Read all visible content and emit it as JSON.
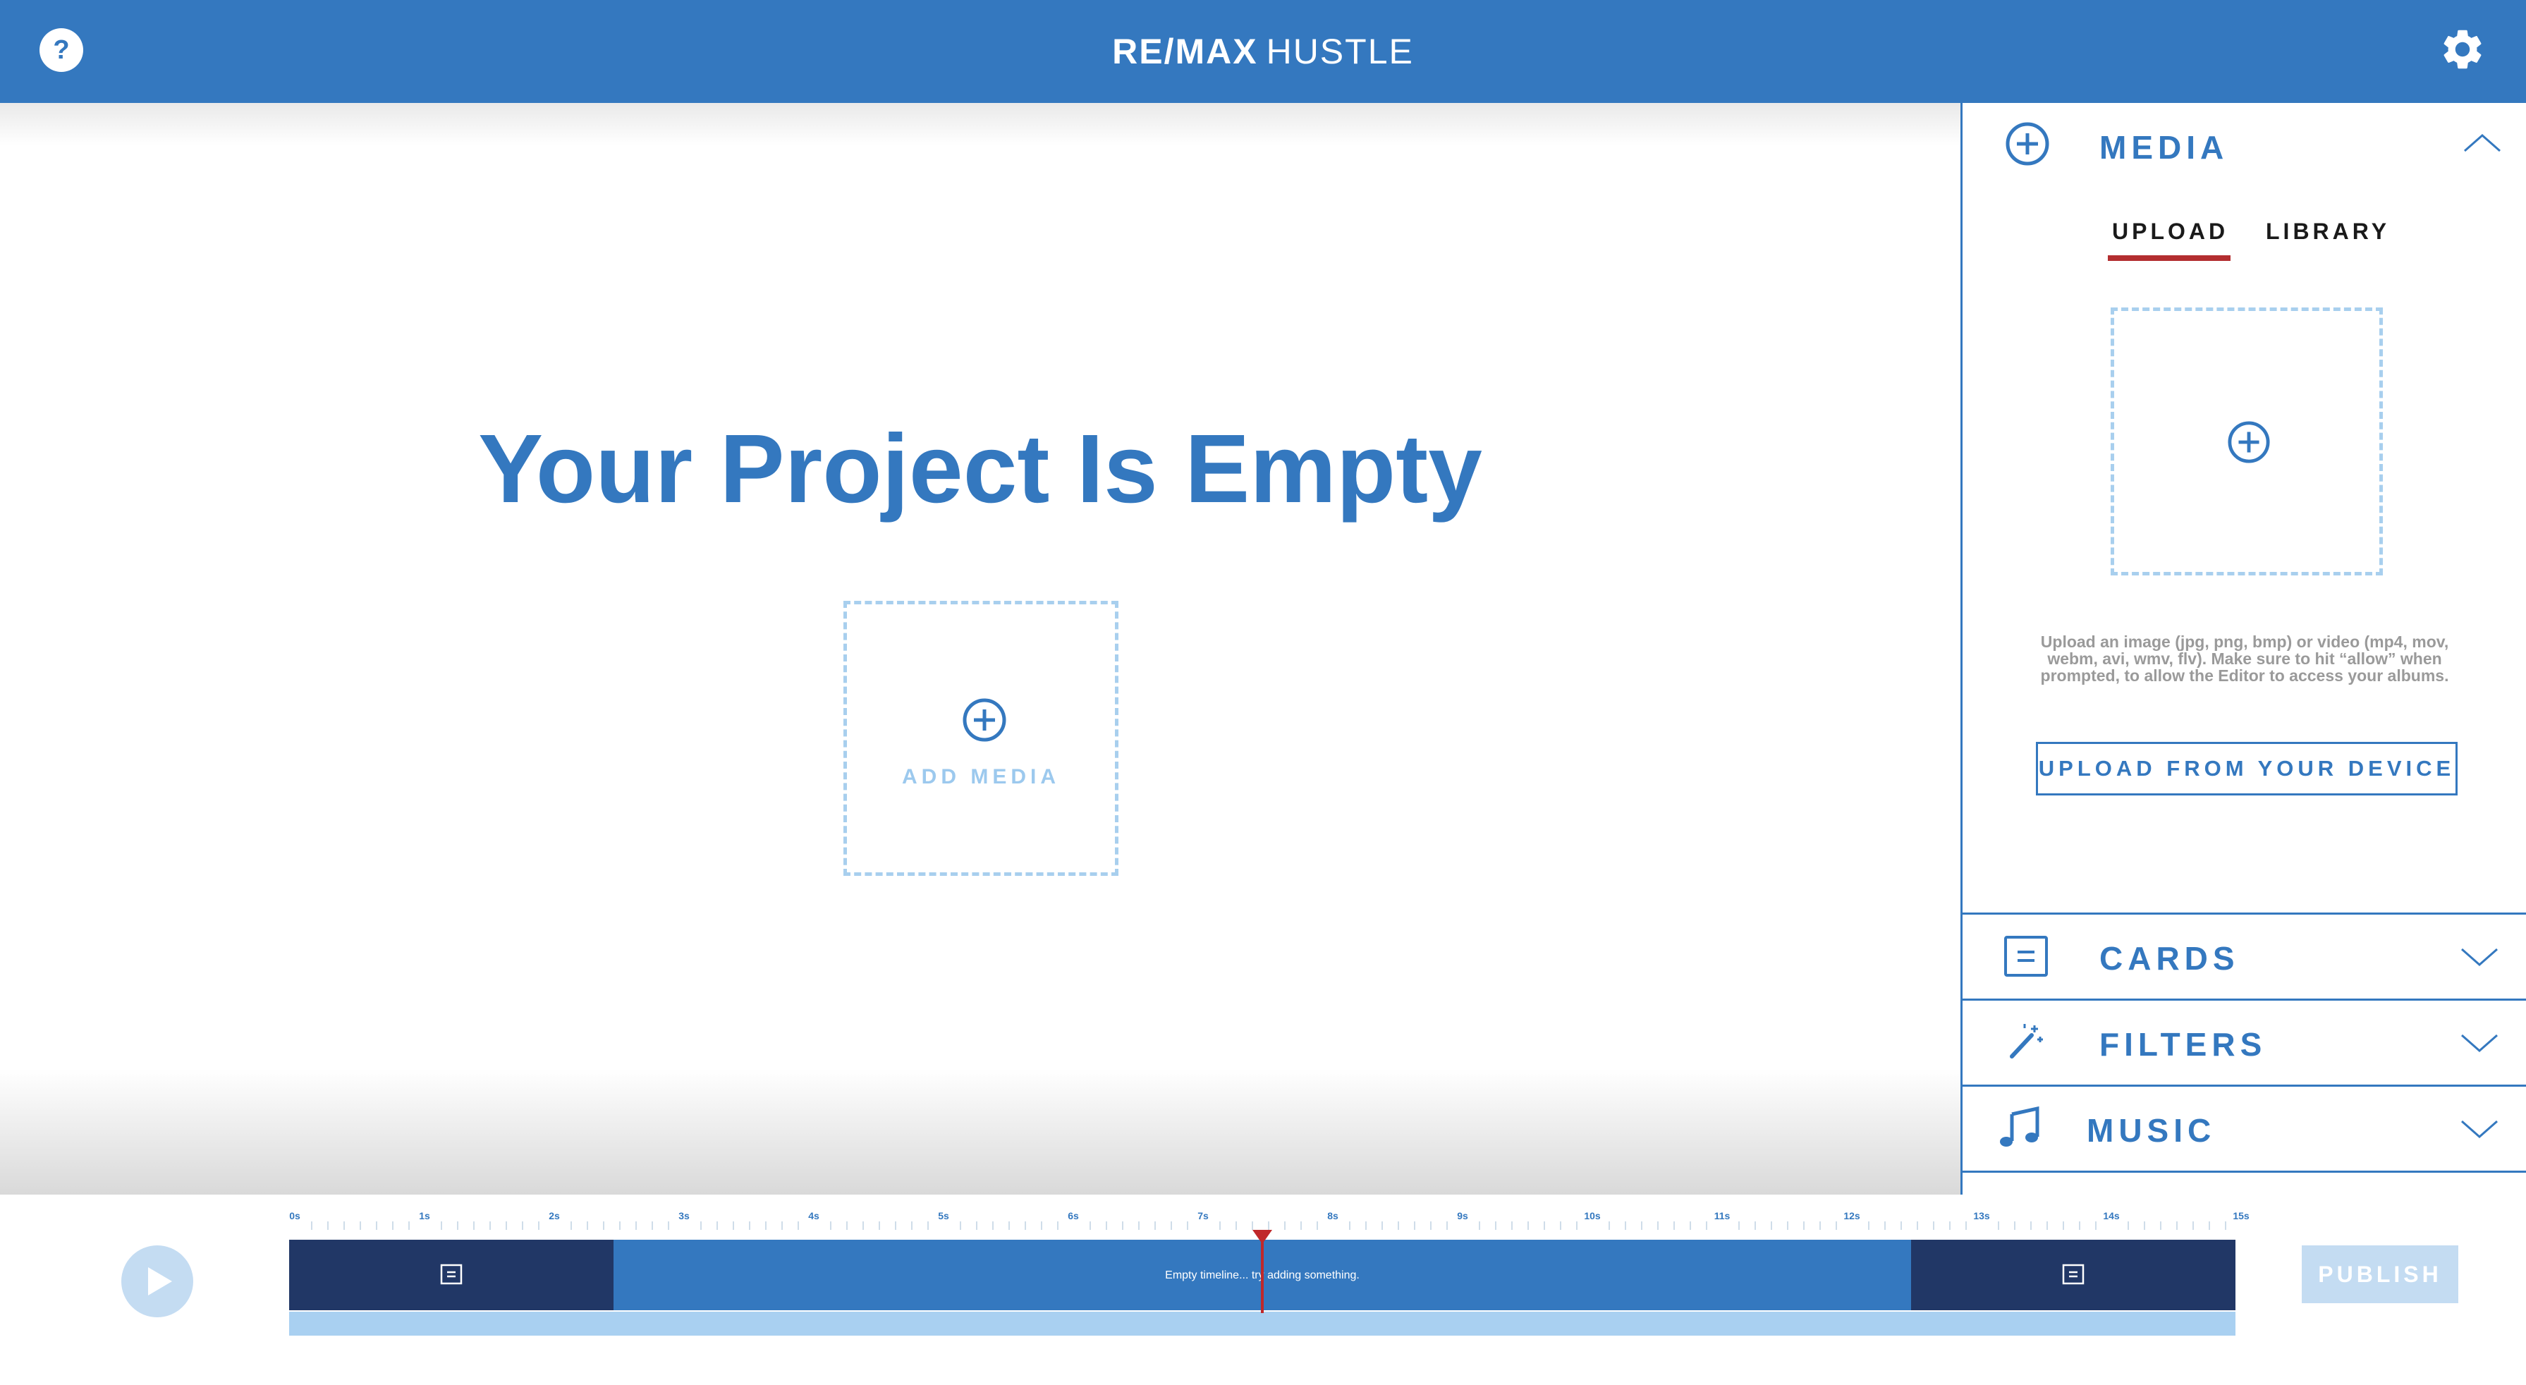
{
  "header": {
    "help_label": "?",
    "brand_primary": "RE/MAX",
    "brand_secondary": "HUSTLE",
    "settings_icon": "gear-icon"
  },
  "stage": {
    "title": "Your Project Is Empty",
    "add_media_label": "ADD MEDIA"
  },
  "sidebar": {
    "media": {
      "title": "MEDIA",
      "expanded": true,
      "tabs": [
        {
          "label": "UPLOAD",
          "active": true
        },
        {
          "label": "LIBRARY",
          "active": false
        }
      ],
      "upload_hint": "Upload an image (jpg, png, bmp) or video (mp4, mov, webm, avi, wmv, flv). Make sure to hit “allow” when prompted, to allow the Editor to access your albums.",
      "upload_button": "UPLOAD FROM YOUR DEVICE"
    },
    "cards": {
      "title": "CARDS",
      "expanded": false
    },
    "filters": {
      "title": "FILTERS",
      "expanded": false
    },
    "music": {
      "title": "MUSIC",
      "expanded": false
    }
  },
  "timeline": {
    "ticks": [
      "0s",
      "1s",
      "2s",
      "3s",
      "4s",
      "5s",
      "6s",
      "7s",
      "8s",
      "9s",
      "10s",
      "11s",
      "12s",
      "13s",
      "14s",
      "15s"
    ],
    "empty_message": "Empty timeline... try adding something.",
    "publish_label": "PUBLISH"
  },
  "colors": {
    "primary": "#3478bf",
    "dark_navy": "#213766",
    "light_blue": "#a9d0f1",
    "accent_red": "#c0282a"
  }
}
